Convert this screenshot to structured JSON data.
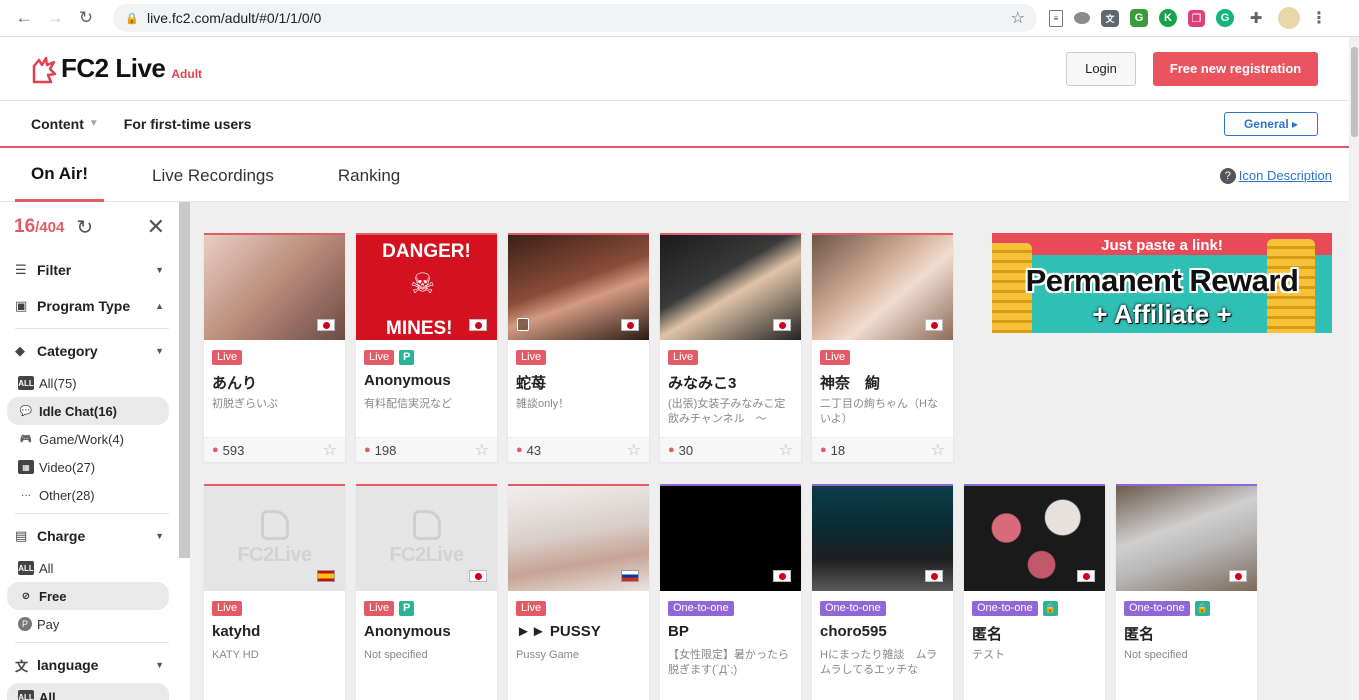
{
  "browser": {
    "url": "live.fc2.com/adult/#0/1/1/0/0",
    "back_icon": "←",
    "forward_icon": "→",
    "reload_icon": "↻"
  },
  "header": {
    "logo_text": "FC2 Live",
    "logo_sub": "Adult",
    "login_label": "Login",
    "register_label": "Free new registration"
  },
  "subnav": {
    "content_label": "Content",
    "first_time_label": "For first-time users",
    "general_label": "General ▸"
  },
  "tabs": {
    "on_air": "On Air!",
    "recordings": "Live Recordings",
    "ranking": "Ranking",
    "icon_description": "Icon Description"
  },
  "sidebar": {
    "count": "16",
    "total": "/404",
    "filter": "Filter",
    "program_type": "Program Type",
    "category": "Category",
    "categories": [
      {
        "label": "All(75)"
      },
      {
        "label": "Idle Chat(16)"
      },
      {
        "label": "Game/Work(4)"
      },
      {
        "label": "Video(27)"
      },
      {
        "label": "Other(28)"
      }
    ],
    "charge": "Charge",
    "charges": [
      {
        "label": "All"
      },
      {
        "label": "Free"
      },
      {
        "label": "Pay"
      }
    ],
    "language": "language",
    "language_all": "All"
  },
  "ad": {
    "top": "Just paste a link!",
    "main": "Permanent Reward",
    "sub": "+ Affiliate +"
  },
  "cards": [
    {
      "badge": "Live",
      "name": "あんり",
      "desc": "初脱ぎらいぶ",
      "viewers": "593"
    },
    {
      "badge": "Live",
      "name": "Anonymous",
      "desc": "有料配信実況など",
      "viewers": "198",
      "thumb_top": "DANGER!",
      "thumb_bottom": "MINES!"
    },
    {
      "badge": "Live",
      "name": "蛇苺",
      "desc": "雑談only！",
      "viewers": "43"
    },
    {
      "badge": "Live",
      "name": "みなみこ3",
      "desc": "(出張)女装子みなみこ定飲みチャンネル　〜",
      "viewers": "30"
    },
    {
      "badge": "Live",
      "name": "神奈　絢",
      "desc": "二丁目の絢ちゃん（Hないよ）",
      "viewers": "18"
    },
    {
      "badge": "Live",
      "name": "katyhd",
      "desc": "KATY HD",
      "placeholder": "FC2Live"
    },
    {
      "badge": "Live",
      "name": "Anonymous",
      "desc": "Not specified",
      "placeholder": "FC2Live"
    },
    {
      "badge": "Live",
      "name": "►► PUSSY",
      "desc": "Pussy Game"
    },
    {
      "badge": "One-to-one",
      "name": "BP",
      "desc": "【女性限定】暑かったら脱ぎます(´Д`;)"
    },
    {
      "badge": "One-to-one",
      "name": "choro595",
      "desc": "Hにまったり雑談　ムラムラしてるエッチな"
    },
    {
      "badge": "One-to-one",
      "name": "匿名",
      "desc": "テスト"
    },
    {
      "badge": "One-to-one",
      "name": "匿名",
      "desc": "Not specified"
    }
  ],
  "p_label": "P",
  "lock_label": "🔒",
  "colors": {
    "accent": "#e35b66",
    "oto": "#9166d6",
    "teal": "#2bb39a",
    "link": "#2c74c5"
  }
}
